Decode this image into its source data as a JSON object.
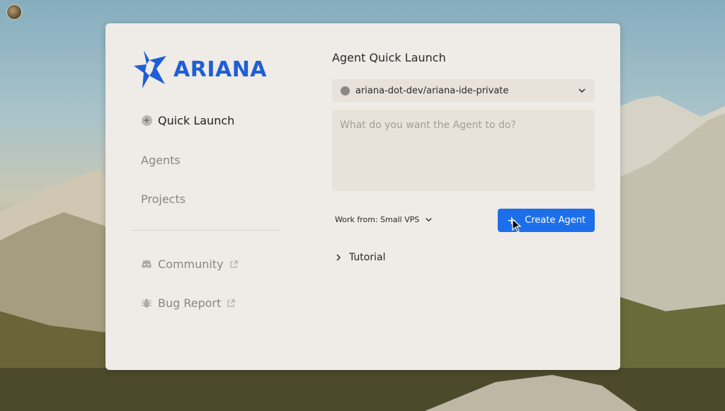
{
  "brand": {
    "name": "ARIANA",
    "color": "#1f5fd6"
  },
  "sidebar": {
    "items": [
      {
        "label": "Quick Launch",
        "icon": "plus-circle-icon",
        "active": true
      },
      {
        "label": "Agents"
      },
      {
        "label": "Projects"
      },
      {
        "label": "Community",
        "icon": "discord-icon",
        "external": true
      },
      {
        "label": "Bug Report",
        "icon": "bug-icon",
        "external": true
      }
    ]
  },
  "main": {
    "title": "Agent Quick Launch",
    "repo_select": {
      "value": "ariana-dot-dev/ariana-ide-private",
      "icon": "github-icon"
    },
    "prompt": {
      "placeholder": "What do you want the Agent to do?",
      "value": ""
    },
    "work_from": {
      "label": "Work from: Small VPS"
    },
    "create_button": {
      "label": "Create Agent",
      "icon": "plus-icon",
      "color": "#1c6fe8"
    },
    "tutorial": {
      "label": "Tutorial"
    }
  }
}
